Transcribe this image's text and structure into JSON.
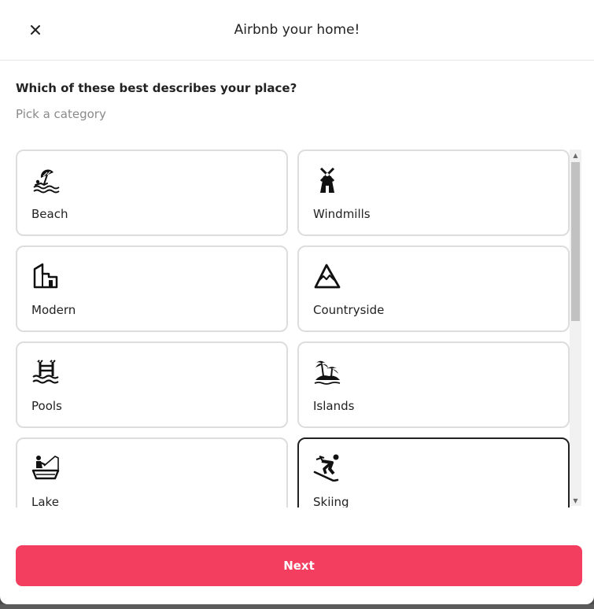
{
  "header": {
    "title": "Airbnb your home!",
    "close_icon": "close-icon"
  },
  "question": "Which of these best describes your place?",
  "subtext": "Pick a category",
  "categories": [
    {
      "label": "Beach",
      "icon": "beach-umbrella-icon",
      "selected": false
    },
    {
      "label": "Windmills",
      "icon": "windmill-icon",
      "selected": false
    },
    {
      "label": "Modern",
      "icon": "modern-building-icon",
      "selected": false
    },
    {
      "label": "Countryside",
      "icon": "mountain-icon",
      "selected": false
    },
    {
      "label": "Pools",
      "icon": "pool-ladder-icon",
      "selected": false
    },
    {
      "label": "Islands",
      "icon": "island-palm-icon",
      "selected": false
    },
    {
      "label": "Lake",
      "icon": "fishing-boat-icon",
      "selected": false
    },
    {
      "label": "Skiing",
      "icon": "skier-icon",
      "selected": true
    }
  ],
  "footer": {
    "next_label": "Next"
  },
  "colors": {
    "accent": "#f33e5f",
    "selected_border": "#222222",
    "card_border": "#dddddd"
  }
}
